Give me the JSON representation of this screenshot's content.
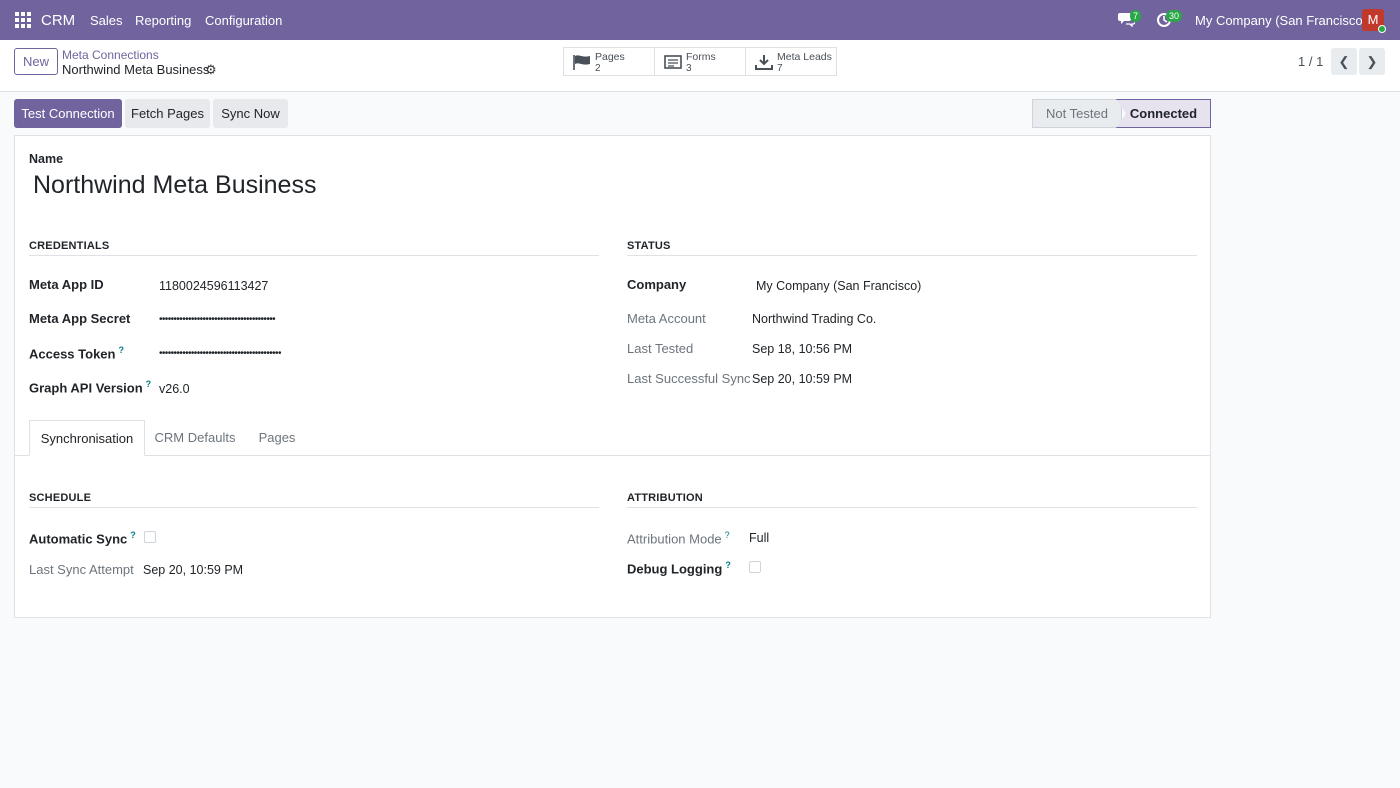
{
  "navbar": {
    "app_name": "CRM",
    "menu": [
      "Sales",
      "Reporting",
      "Configuration"
    ],
    "messages_count": "7",
    "activities_count": "30",
    "company": "My Company (San Francisco)",
    "avatar_initial": "M",
    "accent_color": "#71639e"
  },
  "control_panel": {
    "new_label": "New",
    "breadcrumb_parent": "Meta Connections",
    "breadcrumb_current": "Northwind Meta Business",
    "smart_buttons": [
      {
        "label": "Pages",
        "value": "2",
        "icon": "flag-icon"
      },
      {
        "label": "Forms",
        "value": "3",
        "icon": "form-icon"
      },
      {
        "label": "Meta Leads",
        "value": "7",
        "icon": "download-icon"
      }
    ],
    "pager": "1 / 1"
  },
  "actions": {
    "test_connection": "Test Connection",
    "fetch_pages": "Fetch Pages",
    "sync_now": "Sync Now",
    "status_off": "Not Tested",
    "status_on": "Connected"
  },
  "form": {
    "name_label": "Name",
    "name_value": "Northwind Meta Business",
    "credentials": {
      "heading": "CREDENTIALS",
      "app_id_label": "Meta App ID",
      "app_id_value": "1180024596113427",
      "app_secret_label": "Meta App Secret",
      "app_secret_value": "••••••••••••••••••••••••••••••••••••••••",
      "token_label": "Access Token",
      "token_value": "••••••••••••••••••••••••••••••••••••••••••",
      "graph_label": "Graph API Version",
      "graph_value": "v26.0"
    },
    "status": {
      "heading": "STATUS",
      "company_label": "Company",
      "company_value": "My Company (San Francisco)",
      "account_label": "Meta Account",
      "account_value": "Northwind Trading Co.",
      "last_tested_label": "Last Tested",
      "last_tested_value": "Sep 18, 10:56 PM",
      "last_sync_label": "Last Successful Sync",
      "last_sync_value": "Sep 20, 10:59 PM"
    },
    "tabs": [
      "Synchronisation",
      "CRM Defaults",
      "Pages"
    ],
    "schedule": {
      "heading": "SCHEDULE",
      "auto_sync_label": "Automatic Sync",
      "last_attempt_label": "Last Sync Attempt",
      "last_attempt_value": "Sep 20, 10:59 PM"
    },
    "attribution": {
      "heading": "ATTRIBUTION",
      "mode_label": "Attribution Mode",
      "mode_value": "Full",
      "debug_label": "Debug Logging"
    },
    "help_mark": "?"
  }
}
